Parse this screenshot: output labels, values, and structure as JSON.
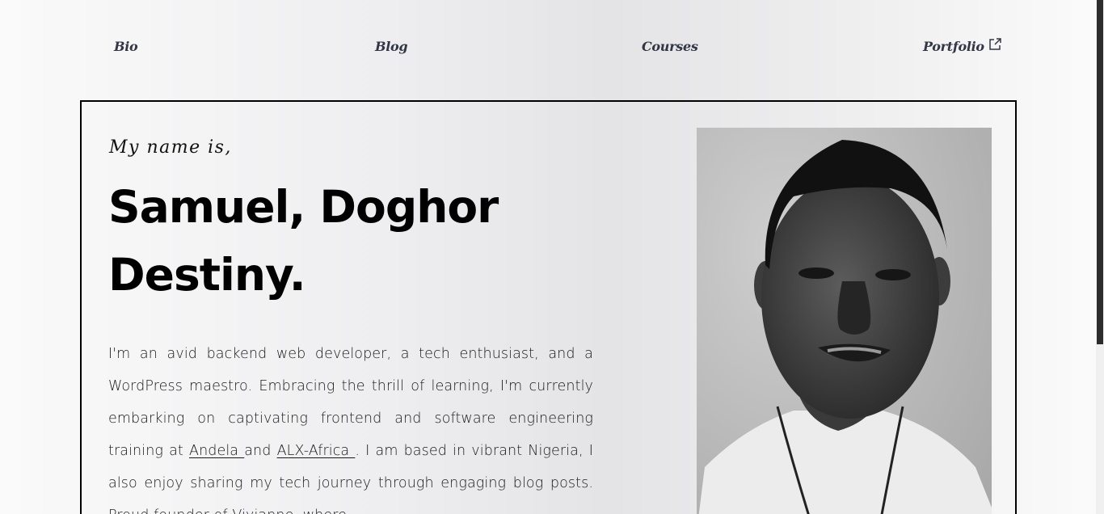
{
  "nav": {
    "items": [
      {
        "label": "Bio"
      },
      {
        "label": "Blog"
      },
      {
        "label": "Courses"
      },
      {
        "label": "Portfolio"
      }
    ]
  },
  "hero": {
    "intro": "My name is,",
    "name": "Samuel, Doghor Destiny.",
    "bio": {
      "part1": "I'm an avid backend web developer, a tech enthusiast, and a WordPress maestro. Embracing the thrill of learning, I'm currently embarking on captivating frontend and software engineering training at ",
      "link1": "Andela ",
      "part2": "and ",
      "link2": "ALX-Africa ",
      "part3": ". I am based in vibrant Nigeria, I also enjoy sharing my tech journey through engaging blog posts. Proud founder of Vivianne, where"
    }
  },
  "colors": {
    "nav_text": "#333645",
    "border": "#000000",
    "scroll_thumb": "#2c2c2c"
  },
  "icons": {
    "external": "external-link-icon"
  }
}
